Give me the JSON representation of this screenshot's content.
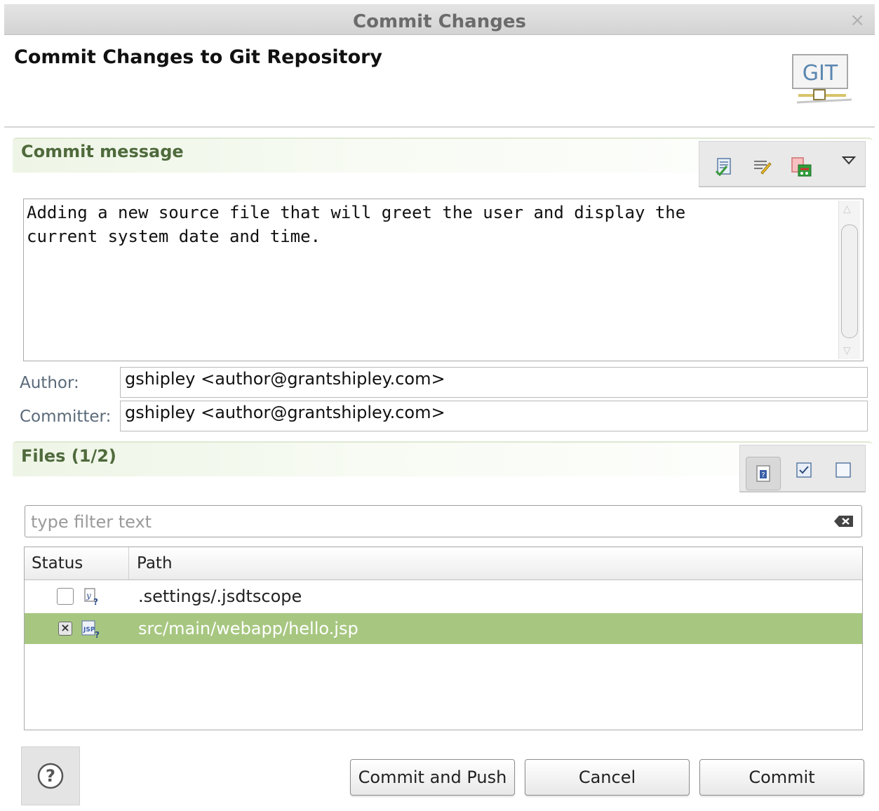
{
  "window": {
    "title": "Commit Changes",
    "close_glyph": "×"
  },
  "header": {
    "heading": "Commit Changes to Git Repository",
    "logo_text": "GIT"
  },
  "commit_message": {
    "section_title": "Commit message",
    "text": "Adding a new source file that will greet the user and display the\ncurrent system date and time.",
    "toolbar": [
      "spell-check-icon",
      "previous-message-icon",
      "sign-off-icon",
      "dropdown-menu-icon"
    ]
  },
  "author": {
    "label": "Author:",
    "value": "gshipley <author@grantshipley.com>"
  },
  "committer": {
    "label": "Committer:",
    "value": "gshipley <author@grantshipley.com>"
  },
  "files": {
    "section_title": "Files (1/2)",
    "toolbar": [
      "show-untracked-icon",
      "select-all-icon",
      "deselect-all-icon"
    ],
    "filter_placeholder": "type filter text",
    "columns": {
      "status": "Status",
      "path": "Path"
    },
    "rows": [
      {
        "path": ".settings/.jsdtscope",
        "checked": false,
        "selected": false
      },
      {
        "path": "src/main/webapp/hello.jsp",
        "checked": true,
        "selected": true
      }
    ]
  },
  "buttons": {
    "help": "?",
    "commit_and_push": "Commit and Push",
    "cancel": "Cancel",
    "commit": "Commit"
  },
  "colors": {
    "selection": "#a7c781",
    "section_title": "#4f6a3c"
  }
}
